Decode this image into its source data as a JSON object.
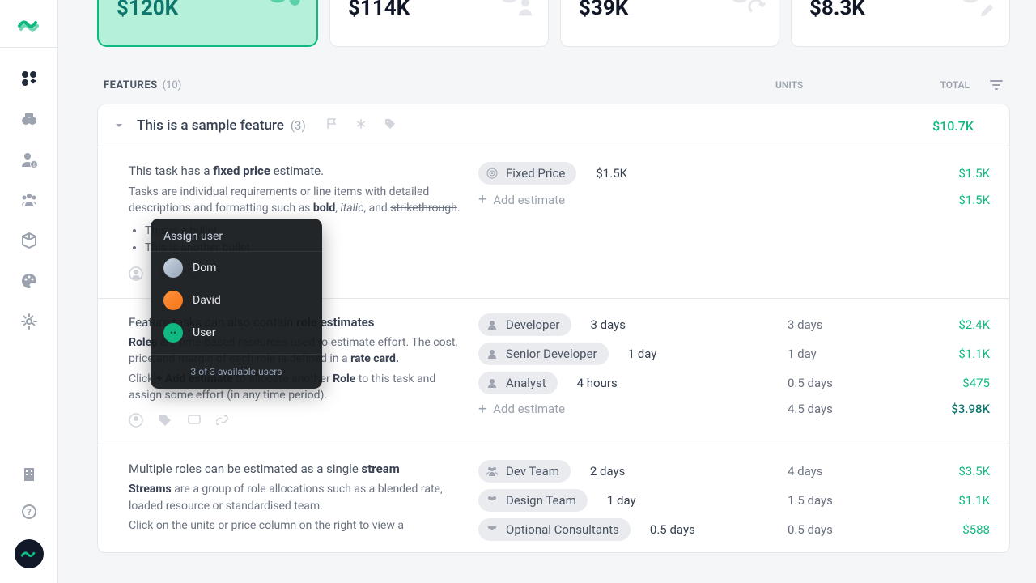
{
  "cards": [
    {
      "value": "$120K"
    },
    {
      "value": "$114K"
    },
    {
      "value": "$39K"
    },
    {
      "value": "$8.3K"
    }
  ],
  "features_header": {
    "title": "FEATURES",
    "count": "(10)",
    "units": "UNITS",
    "total": "TOTAL"
  },
  "feature_row": {
    "title": "This is a sample feature",
    "count": "(3)",
    "total": "$10.7K"
  },
  "task1": {
    "line1a": "This task has a ",
    "line1b": "fixed price",
    "line1c": " estimate.",
    "sub1": "Tasks are individual requirements or line items with detailed descriptions and formatting such as ",
    "sub_bold": "bold",
    "sub_sep": ", ",
    "sub_italic": "italic",
    "sub_and": ", and ",
    "sub_strike": "strikethrough",
    "sub_end": ".",
    "bullets": [
      "This is a bullet",
      "This is another bullet"
    ],
    "chip": "Fixed Price",
    "chip_amount": "$1.5K",
    "add": "Add estimate",
    "total1": "$1.5K",
    "total2": "$1.5K"
  },
  "task2": {
    "line1a": "Feature tasks can also contain ",
    "line1b": "role estimates",
    "p2a": "Roles",
    "p2b": " are time-based resources used to estimate effort. The cost, price and margin of each role is defined in a ",
    "p2c": "rate card.",
    "p3a": "Click ",
    "p3b": "+ Add estimate",
    "p3c": " to allocate another ",
    "p3d": "Role",
    "p3e": " to this task and assign some effort (in any time period).",
    "roles": [
      {
        "chip": "Developer",
        "amount": "3 days",
        "units": "3 days",
        "total": "$2.4K"
      },
      {
        "chip": "Senior Developer",
        "amount": "1 day",
        "units": "1 day",
        "total": "$1.1K"
      },
      {
        "chip": "Analyst",
        "amount": "4 hours",
        "units": "0.5 days",
        "total": "$475"
      }
    ],
    "add": "Add estimate",
    "sum_units": "4.5 days",
    "sum_total": "$3.98K"
  },
  "task3": {
    "line1a": "Multiple roles can be estimated as a single ",
    "line1b": "stream",
    "p2a": "Streams",
    "p2b": " are a group of role allocations such as a blended rate, loaded resource or standardised team.",
    "p3": "Click on the units or price column on the right to view a",
    "streams": [
      {
        "chip": "Dev Team",
        "amount": "2 days",
        "units": "4 days",
        "total": "$3.5K"
      },
      {
        "chip": "Design Team",
        "amount": "1 day",
        "units": "1.5 days",
        "total": "$1.1K"
      },
      {
        "chip": "Optional Consultants",
        "amount": "0.5 days",
        "units": "0.5 days",
        "total": "$588"
      }
    ]
  },
  "popover": {
    "title": "Assign user",
    "items": [
      "Dom",
      "David",
      "User"
    ],
    "footer": "3 of 3 available users"
  }
}
